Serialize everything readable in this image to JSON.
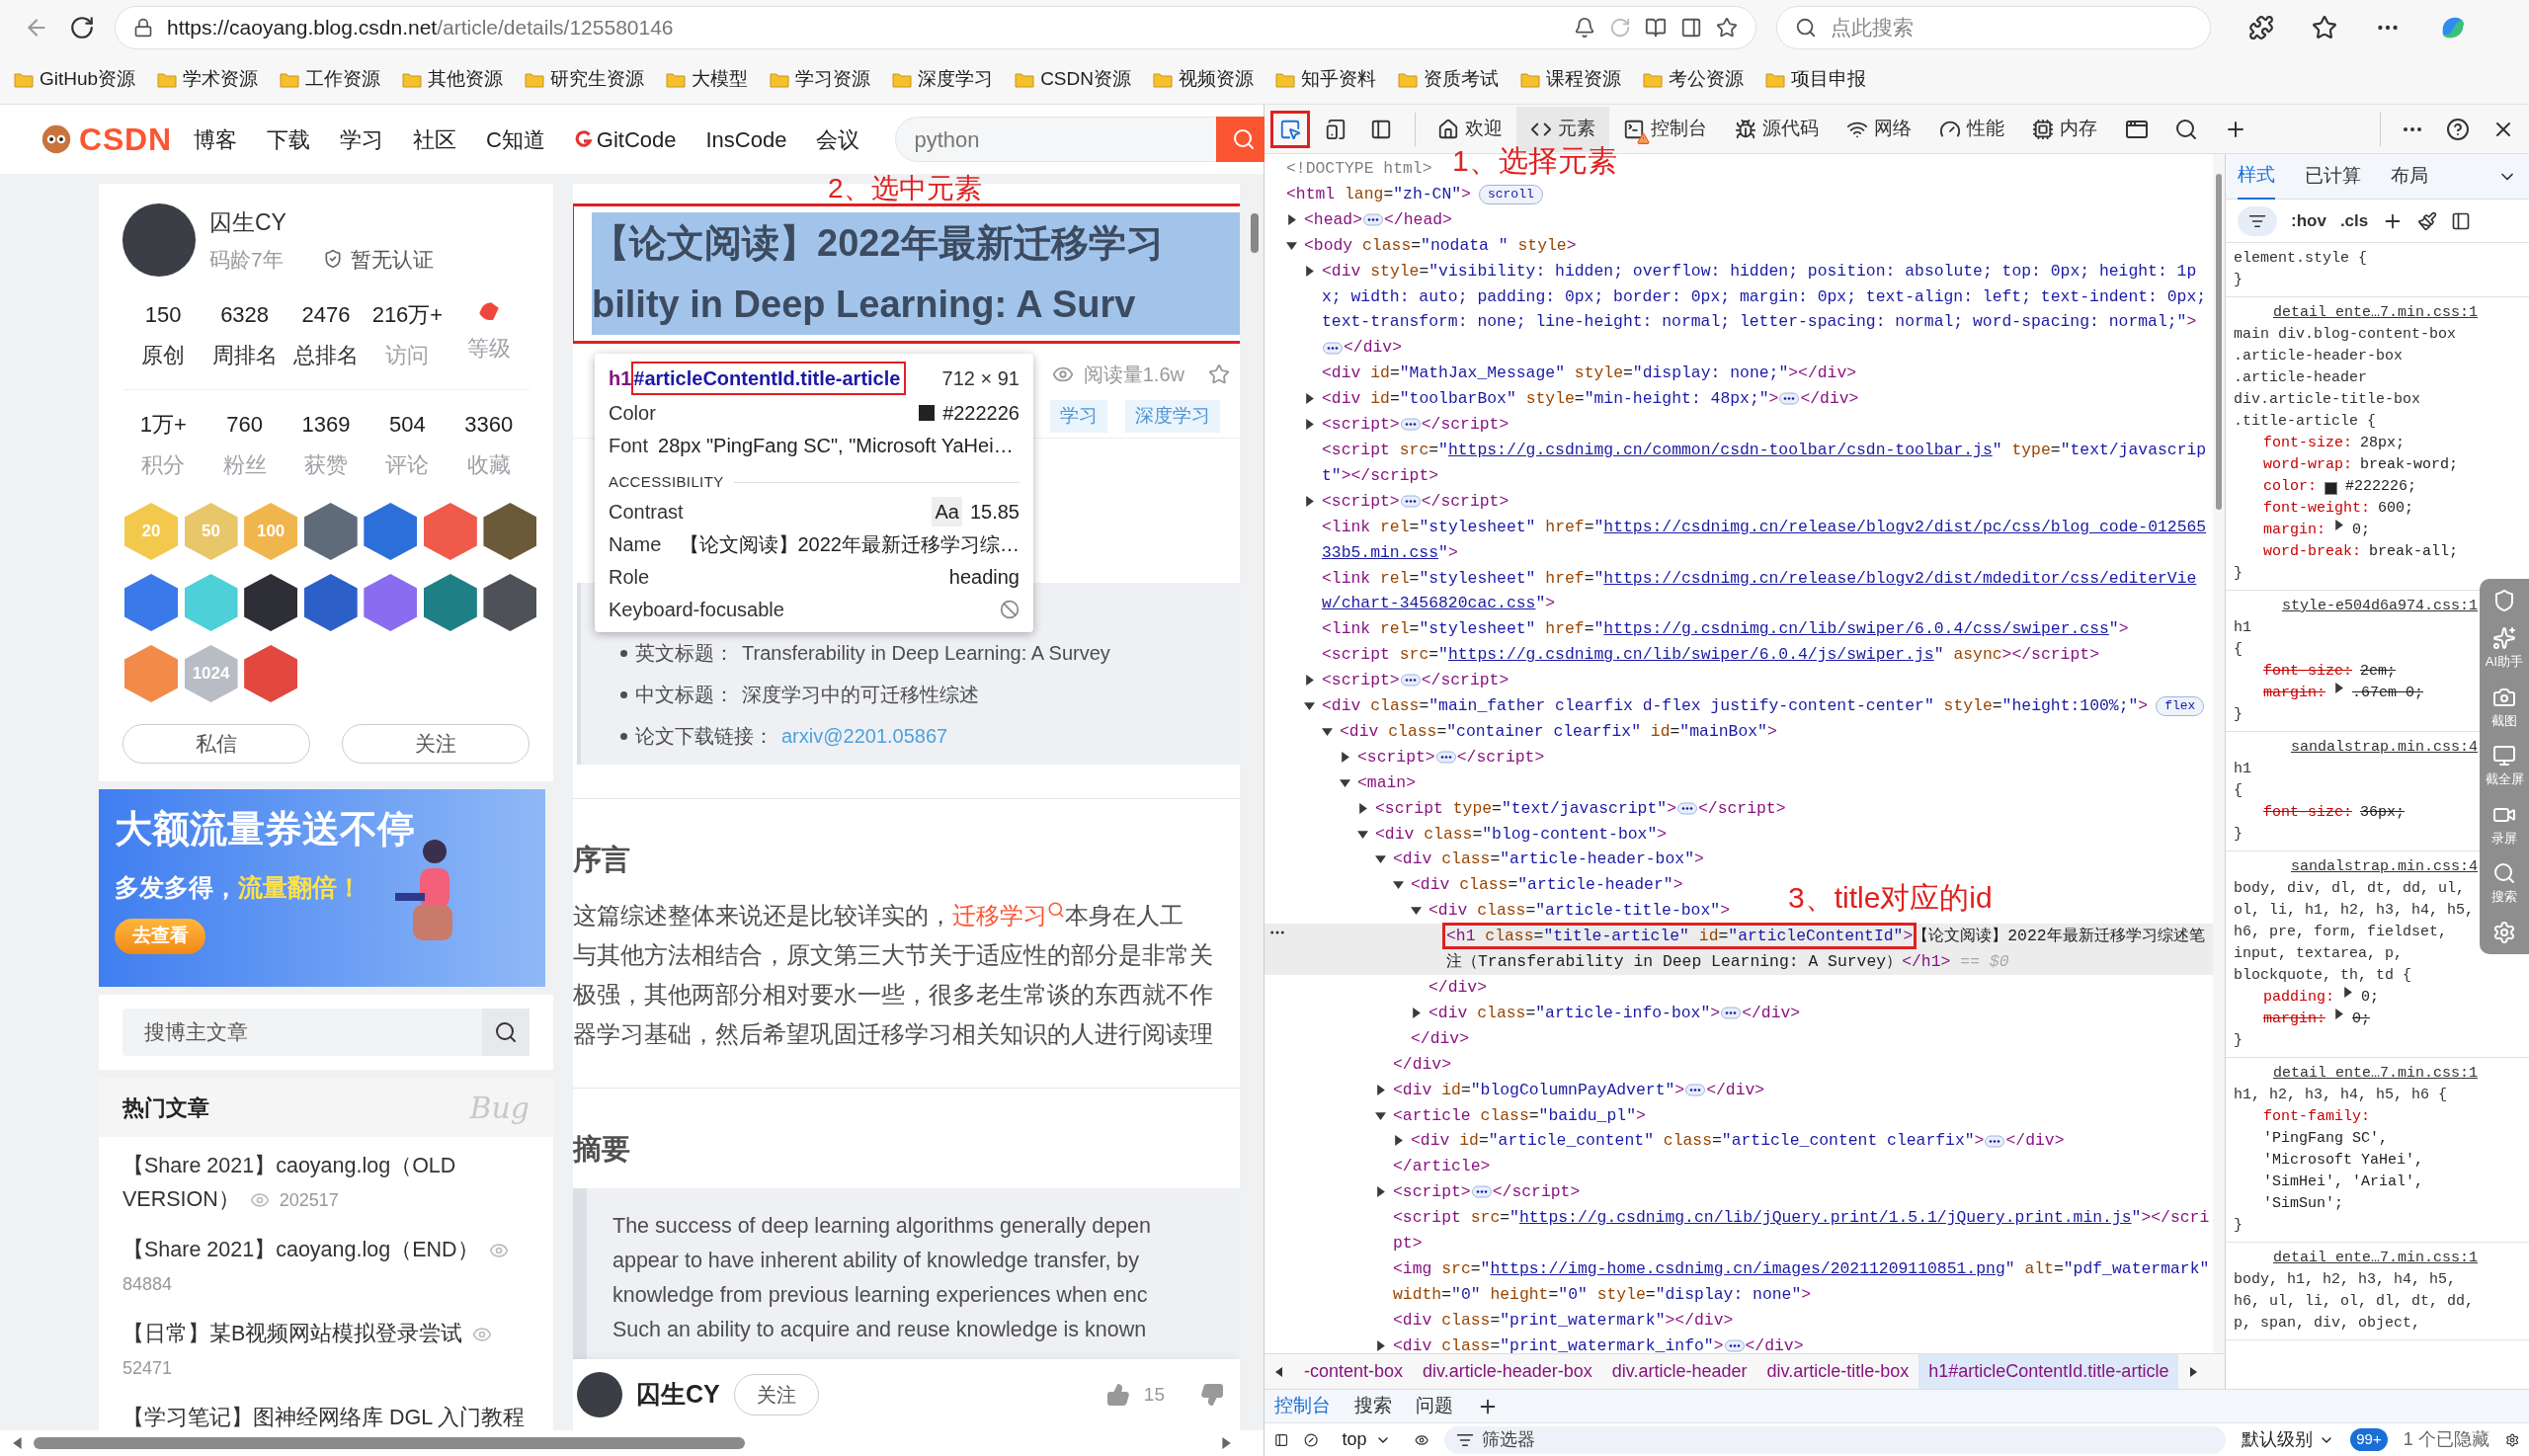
{
  "browser": {
    "url_host": "https://caoyang.blog.csdn.net",
    "url_path": "/article/details/125580146",
    "search": {
      "placeholder": "点此搜索"
    }
  },
  "bookmarks": [
    {
      "label": "GitHub资源"
    },
    {
      "label": "学术资源"
    },
    {
      "label": "工作资源"
    },
    {
      "label": "其他资源"
    },
    {
      "label": "研究生资源"
    },
    {
      "label": "大模型"
    },
    {
      "label": "学习资源"
    },
    {
      "label": "深度学习"
    },
    {
      "label": "CSDN资源"
    },
    {
      "label": "视频资源"
    },
    {
      "label": "知乎资料"
    },
    {
      "label": "资质考试"
    },
    {
      "label": "课程资源"
    },
    {
      "label": "考公资源"
    },
    {
      "label": "项目申报"
    }
  ],
  "page": {
    "logo": "CSDN",
    "nav": [
      {
        "label": "博客",
        "kind": "text"
      },
      {
        "label": "下载",
        "kind": "text"
      },
      {
        "label": "学习",
        "kind": "text"
      },
      {
        "label": "社区",
        "kind": "text"
      },
      {
        "label": "C知道",
        "kind": "text"
      },
      {
        "label": "GitCode",
        "kind": "gitcode"
      },
      {
        "label": "InsCode",
        "kind": "text"
      },
      {
        "label": "会议",
        "kind": "text"
      }
    ],
    "search": {
      "placeholder": "python"
    },
    "profile": {
      "name": "囚生CY",
      "age": "码龄7年",
      "certification": "暂无认证",
      "stats": [
        {
          "kind": "number",
          "value": "150",
          "label": "原创",
          "muted": false
        },
        {
          "kind": "number",
          "value": "6328",
          "label": "周排名",
          "muted": false
        },
        {
          "kind": "number",
          "value": "2476",
          "label": "总排名",
          "muted": false
        },
        {
          "kind": "number",
          "value": "216万+",
          "label": "访问",
          "muted": true
        },
        {
          "kind": "icon",
          "label": "等级",
          "muted": true
        }
      ],
      "stats2": [
        {
          "kind": "number",
          "value": "1万+",
          "label": "积分",
          "muted": true
        },
        {
          "kind": "number",
          "value": "760",
          "label": "粉丝",
          "muted": true
        },
        {
          "kind": "number",
          "value": "1369",
          "label": "获赞",
          "muted": true
        },
        {
          "kind": "number",
          "value": "504",
          "label": "评论",
          "muted": true
        },
        {
          "kind": "number",
          "value": "3360",
          "label": "收藏",
          "muted": true
        }
      ],
      "badges": [
        {
          "color": "#f2c94c",
          "label": "20"
        },
        {
          "color": "#e8c66a",
          "label": "50"
        },
        {
          "color": "#f0b54c",
          "label": "100"
        },
        {
          "color": "#5f6b78"
        },
        {
          "color": "#2d6fd8"
        },
        {
          "color": "#f05a4a"
        },
        {
          "color": "#6b5a3a"
        },
        {
          "color": "#3a79e8"
        },
        {
          "color": "#4dd0d8"
        },
        {
          "color": "#2e2e36"
        },
        {
          "color": "#2d5fc8"
        },
        {
          "color": "#8a6cf0"
        },
        {
          "color": "#1f7f86"
        },
        {
          "color": "#4e5258"
        },
        {
          "color": "#f28a4a"
        },
        {
          "color": "#b8bcc4",
          "label": "1024"
        },
        {
          "color": "#e2483d"
        }
      ],
      "buttons": [
        {
          "label": "私信"
        },
        {
          "label": "关注"
        }
      ]
    },
    "banner": {
      "title": "大额流量券送不停",
      "subtitle": "多发多得，",
      "highlight": "流量翻倍！",
      "button": "去查看"
    },
    "blog_search": {
      "placeholder": "搜博主文章"
    },
    "hot": {
      "title": "热门文章",
      "decoration": "Bug",
      "articles": [
        {
          "title": "【Share 2021】caoyang.log（OLD VERSION）",
          "views": "202517"
        },
        {
          "title": "【Share 2021】caoyang.log（END）",
          "views": "84884"
        },
        {
          "title": "【日常】某B视频网站模拟登录尝试",
          "views": "52471"
        },
        {
          "title": "【学习笔记】图神经网络库 DGL 入门教程"
        }
      ]
    },
    "article": {
      "annotation": "2、选中元素",
      "title_lines": [
        "【论文阅读】2022年最新迁移学习",
        "bility in Deep Learning: A Surv"
      ],
      "highlighted": true,
      "reads": "阅读量1.6w",
      "tags": [
        "学习",
        "深度学习"
      ],
      "inspector": {
        "tag": "h1",
        "selector": "#articleContentId.title-article",
        "size": "712 × 91",
        "color_label": "Color",
        "color": "#222226",
        "color_value": "#222226",
        "font_label": "Font",
        "font_value": "28px \"PingFang SC\", \"Microsoft YaHei…",
        "section": "ACCESSIBILITY",
        "contrast_label": "Contrast",
        "contrast_sample": "Aa",
        "contrast_value": "15.85",
        "name_label": "Name",
        "name_value": "【论文阅读】2022年最新迁移学习综…",
        "role_label": "Role",
        "role_value": "heading",
        "focus_label": "Keyboard-focusable",
        "focusable": false
      },
      "info_items": [
        {
          "label": "英文标题：",
          "text": "Transferability in Deep Learning: A Survey",
          "kind": "text"
        },
        {
          "label": "中文标题：",
          "text": "深度学习中的可迁移性综述",
          "kind": "text"
        },
        {
          "label": "论文下载链接：",
          "text": "arxiv@2201.05867",
          "kind": "link"
        }
      ],
      "sections": [
        {
          "heading": "序言",
          "kind": "paragraph",
          "lines": [
            [
              {
                "kind": "text",
                "text": "这篇综述整体来说还是比较详实的，"
              },
              {
                "kind": "link",
                "text": "迁移学习"
              },
              {
                "kind": "text",
                "text": "本身在人工"
              }
            ],
            [
              {
                "kind": "text",
                "text": "与其他方法相结合，原文第三大节关于适应性的部分是非常关"
              }
            ],
            [
              {
                "kind": "text",
                "text": "极强，其他两部分相对要水一些，很多老生常谈的东西就不作"
              }
            ],
            [
              {
                "kind": "text",
                "text": "器学习基础，然后希望巩固迁移学习相关知识的人进行阅读理"
              }
            ]
          ]
        },
        {
          "heading": "摘要",
          "kind": "quote",
          "lines": [
            [
              {
                "kind": "text",
                "text": "The success of deep learning algorithms generally depen"
              }
            ],
            [
              {
                "kind": "text",
                "text": "appear to have inherent ability of knowledge transfer, by"
              }
            ],
            [
              {
                "kind": "text",
                "text": "knowledge from previous learning experiences when enc"
              }
            ],
            [
              {
                "kind": "text",
                "text": "Such an ability to acquire and reuse knowledge is known"
              }
            ]
          ]
        }
      ]
    },
    "author_bar": {
      "name": "囚生CY",
      "follow": "关注",
      "likes": "15"
    }
  },
  "devtools": {
    "tools": [
      {
        "kind": "inspect",
        "selected": true
      },
      {
        "kind": "device",
        "selected": false
      },
      {
        "kind": "dock",
        "selected": false
      }
    ],
    "tabs": [
      {
        "kind": "home",
        "label": "欢迎",
        "selected": false,
        "warning": false
      },
      {
        "kind": "code",
        "label": "元素",
        "selected": true,
        "warning": false
      },
      {
        "kind": "console",
        "label": "控制台",
        "selected": false,
        "warning": true
      },
      {
        "kind": "bug",
        "label": "源代码",
        "selected": false,
        "warning": false
      },
      {
        "kind": "wifi",
        "label": "网络",
        "selected": false,
        "warning": false
      },
      {
        "kind": "gauge",
        "label": "性能",
        "selected": false,
        "warning": false
      },
      {
        "kind": "cpu",
        "label": "内存",
        "selected": false,
        "warning": false
      }
    ],
    "annotation": "1、选择元素",
    "dom_annotation": "3、title对应的id",
    "dom": [
      {
        "kind": "doctype",
        "open": "<!DOCTYPE html>"
      },
      {
        "kind": "root",
        "open": "<html lang=\"zh-CN\">",
        "badge": "scroll",
        "children": [
          {
            "kind": "collapsed",
            "open": "<head>",
            "close": "</head>"
          },
          {
            "kind": "expanded",
            "open": "<body class=\"nodata \" style>",
            "children": [
              {
                "kind": "collapsed",
                "open": "<div style=\"visibility: hidden; overflow: hidden; position: absolute; top: 0px; height: 1px; width: auto; padding: 0px; border: 0px; margin: 0px; text-align: left; text-indent: 0px; text-transform: none; line-height: normal; letter-spacing: normal; word-spacing: normal;\">",
                "close": "</div>"
              },
              {
                "kind": "leaf",
                "open": "<div id=\"MathJax_Message\" style=\"display: none;\">",
                "close": "</div>"
              },
              {
                "kind": "collapsed",
                "open": "<div id=\"toolbarBox\" style=\"min-height: 48px;\">",
                "close": "</div>"
              },
              {
                "kind": "collapsed",
                "open": "<script>",
                "close": "</script>"
              },
              {
                "kind": "leaf",
                "open": "<script src=\"https://g.csdnimg.cn/common/csdn-toolbar/csdn-toolbar.js\" type=\"text/javascript\">",
                "close": "</script>"
              },
              {
                "kind": "collapsed",
                "open": "<script>",
                "close": "</script>"
              },
              {
                "kind": "leaf",
                "open": "<link rel=\"stylesheet\" href=\"https://csdnimg.cn/release/blogv2/dist/pc/css/blog_code-01256533b5.min.css\">"
              },
              {
                "kind": "leaf",
                "open": "<link rel=\"stylesheet\" href=\"https://csdnimg.cn/release/blogv2/dist/mdeditor/css/editerView/chart-3456820cac.css\">"
              },
              {
                "kind": "leaf",
                "open": "<link rel=\"stylesheet\" href=\"https://g.csdnimg.cn/lib/swiper/6.0.4/css/swiper.css\">"
              },
              {
                "kind": "leaf",
                "open": "<script src=\"https://g.csdnimg.cn/lib/swiper/6.0.4/js/swiper.js\" async>",
                "close": "</script>"
              },
              {
                "kind": "collapsed",
                "open": "<script>",
                "close": "</script>"
              },
              {
                "kind": "expanded",
                "open": "<div class=\"main_father clearfix d-flex justify-content-center\" style=\"height:100%;\">",
                "badge": "flex",
                "children": [
                  {
                    "kind": "expanded",
                    "open": "<div class=\"container clearfix\" id=\"mainBox\">",
                    "children": [
                      {
                        "kind": "collapsed",
                        "open": "<script>",
                        "close": "</script>"
                      },
                      {
                        "kind": "expanded",
                        "open": "<main>",
                        "children": [
                          {
                            "kind": "collapsed",
                            "open": "<script type=\"text/javascript\">",
                            "close": "</script>"
                          },
                          {
                            "kind": "expanded",
                            "open": "<div class=\"blog-content-box\">",
                            "children": [
                              {
                                "kind": "expanded",
                                "open": "<div class=\"article-header-box\">",
                                "close": "</div>",
                                "children": [
                                  {
                                    "kind": "expanded",
                                    "open": "<div class=\"article-header\">",
                                    "close": "</div>",
                                    "children": [
                                      {
                                        "kind": "expanded",
                                        "open": "<div class=\"article-title-box\">",
                                        "close": "</div>",
                                        "children": [
                                          {
                                            "kind": "leaf",
                                            "open": "<h1 class=\"title-article\" id=\"articleContentId\">",
                                            "content": "【论文阅读】2022年最新迁移学习综述笔注（Transferability in Deep Learning: A Survey）",
                                            "close": "</h1>",
                                            "suffix": "== $0",
                                            "selected": true,
                                            "annotated": true
                                          }
                                        ]
                                      },
                                      {
                                        "kind": "collapsed",
                                        "open": "<div class=\"article-info-box\">",
                                        "close": "</div>"
                                      }
                                    ]
                                  }
                                ]
                              },
                              {
                                "kind": "collapsed",
                                "open": "<div id=\"blogColumnPayAdvert\">",
                                "close": "</div>"
                              },
                              {
                                "kind": "expanded",
                                "open": "<article class=\"baidu_pl\">",
                                "close": "</article>",
                                "children": [
                                  {
                                    "kind": "collapsed",
                                    "open": "<div id=\"article_content\" class=\"article_content clearfix\">",
                                    "close": "</div>"
                                  }
                                ]
                              },
                              {
                                "kind": "collapsed",
                                "open": "<script>",
                                "close": "</script>"
                              },
                              {
                                "kind": "leaf",
                                "open": "<script src=\"https://g.csdnimg.cn/lib/jQuery.print/1.5.1/jQuery.print.min.js\">",
                                "close": "</script>"
                              },
                              {
                                "kind": "leaf",
                                "open": "<img src=\"https://img-home.csdnimg.cn/images/20211209110851.png\" alt=\"pdf_watermark\" width=\"0\" height=\"0\" style=\"display: none\">"
                              },
                              {
                                "kind": "leaf",
                                "open": "<div class=\"print_watermark\">",
                                "close": "</div>"
                              },
                              {
                                "kind": "collapsed",
                                "open": "<div class=\"print_watermark_info\">",
                                "close": "</div>"
                              }
                            ]
                          }
                        ]
                      }
                    ]
                  }
                ]
              }
            ]
          }
        ]
      }
    ],
    "breadcrumb": [
      {
        "label": "-content-box",
        "selected": false
      },
      {
        "label": "div.article-header-box",
        "selected": false
      },
      {
        "label": "div.article-header",
        "selected": false
      },
      {
        "label": "div.article-title-box",
        "selected": false
      },
      {
        "label": "h1#articleContentId.title-article",
        "selected": true
      }
    ],
    "styles": {
      "tabs": [
        {
          "label": "样式",
          "selected": true
        },
        {
          "label": "已计算",
          "selected": false
        },
        {
          "label": "布局",
          "selected": false
        }
      ],
      "filter": {
        "hov": ":hov",
        "cls": ".cls"
      },
      "rules": [
        {
          "selector": "element.style {",
          "end": "}"
        },
        {
          "source": "detail_ente…7.min.css:1",
          "selector": "main div.blog-content-box .article-header-box .article-header div.article-title-box .title-article {",
          "end": "}",
          "properties": [
            {
              "kind": "plain",
              "name": "font-size:",
              "value": "28px;",
              "overridden": false
            },
            {
              "kind": "plain",
              "name": "word-wrap:",
              "value": "break-word;",
              "overridden": false
            },
            {
              "kind": "color",
              "name": "color:",
              "value": "#222226;",
              "color": "#222226",
              "overridden": false
            },
            {
              "kind": "plain",
              "name": "font-weight:",
              "value": "600;",
              "overridden": false
            },
            {
              "kind": "shorthand",
              "name": "margin:",
              "value": "0;",
              "overridden": false
            },
            {
              "kind": "plain",
              "name": "word-break:",
              "value": "break-all;",
              "overridden": false
            }
          ]
        },
        {
          "source": "style-e504d6a974.css:1",
          "selector": "h1",
          "brace": "{",
          "end": "}",
          "properties": [
            {
              "kind": "plain",
              "name": "font-size:",
              "value": "2em;",
              "overridden": true
            },
            {
              "kind": "shorthand",
              "name": "margin:",
              "value": ".67em 0;",
              "overridden": true
            }
          ]
        },
        {
          "source": "sandalstrap.min.css:4",
          "selector": "h1",
          "brace": "{",
          "end": "}",
          "properties": [
            {
              "kind": "plain",
              "name": "font-size:",
              "value": "36px;",
              "overridden": true
            }
          ]
        },
        {
          "source": "sandalstrap.min.css:4",
          "selector": "body, div, dl, dt, dd, ul, ol, li, h1, h2, h3, h4, h5, h6, pre, form, fieldset, input, textarea, p, blockquote, th, td {",
          "end": "}",
          "properties": [
            {
              "kind": "shorthand",
              "name": "padding:",
              "value": "0;",
              "overridden": false
            },
            {
              "kind": "shorthand",
              "name": "margin:",
              "value": "0;",
              "overridden": true
            }
          ]
        },
        {
          "source": "detail_ente…7.min.css:1",
          "selector": "h1, h2, h3, h4, h5, h6 {",
          "end": "}",
          "properties": [
            {
              "kind": "plain",
              "name": "font-family:",
              "value": "'PingFang SC', 'Microsoft YaHei', 'SimHei', 'Arial', 'SimSun';",
              "overridden": false
            }
          ]
        },
        {
          "source": "detail_ente…7.min.css:1",
          "selector": "body, h1, h2, h3, h4, h5, h6, ul, li, ol, dl, dt, dd, p, span, div, object,"
        }
      ]
    },
    "side_tools": [
      {
        "kind": "shield"
      },
      {
        "kind": "ai",
        "label": "AI助手"
      },
      {
        "kind": "camera",
        "label": "截图"
      },
      {
        "kind": "screen",
        "label": "截全屏"
      },
      {
        "kind": "video",
        "label": "录屏"
      },
      {
        "kind": "search",
        "label": "搜索"
      },
      {
        "kind": "gear"
      }
    ],
    "drawer": {
      "tabs": [
        {
          "label": "控制台",
          "selected": true
        },
        {
          "label": "搜索",
          "selected": false
        },
        {
          "label": "问题",
          "selected": false
        }
      ],
      "context": "top",
      "filter": {
        "placeholder": "筛选器"
      },
      "level": "默认级别",
      "count": "99+",
      "hidden": "1 个已隐藏"
    }
  }
}
